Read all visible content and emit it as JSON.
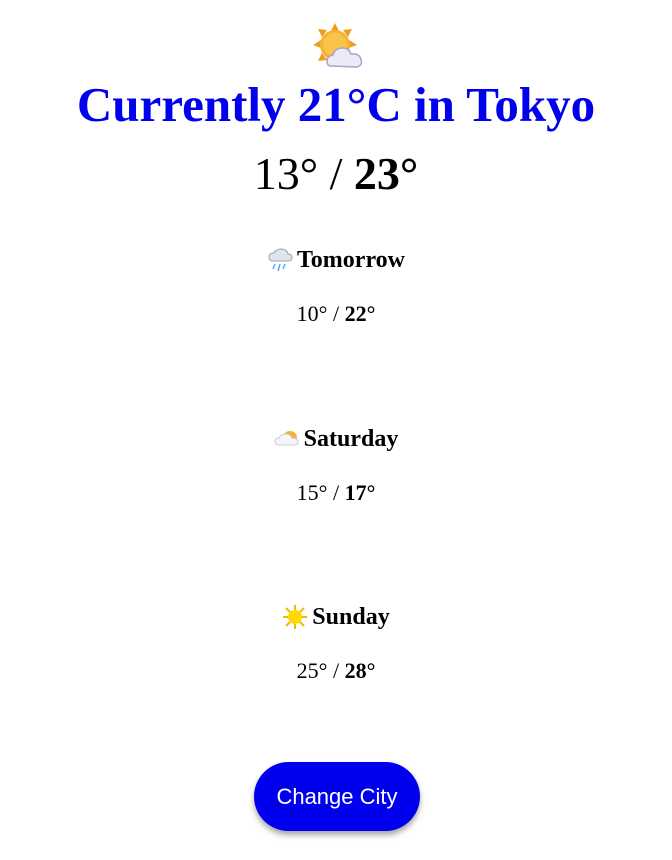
{
  "current": {
    "icon": "sun-behind-cloud-icon",
    "title": "Currently 21°C in Tokyo",
    "low": "13°",
    "separator": "/",
    "high": "23°"
  },
  "forecast": [
    {
      "icon": "cloud-with-rain-icon",
      "day": "Tomorrow",
      "low": "10°",
      "separator": "/",
      "high": "22°"
    },
    {
      "icon": "sun-behind-cloud-icon",
      "day": "Saturday",
      "low": "15°",
      "separator": "/",
      "high": "17°"
    },
    {
      "icon": "sun-icon",
      "day": "Sunday",
      "low": "25°",
      "separator": "/",
      "high": "28°"
    }
  ],
  "button": {
    "label": "Change City",
    "color": "#0000ee"
  },
  "colors": {
    "title": "#0000ee",
    "button_bg": "#0000ee",
    "button_text": "#ffffff"
  }
}
